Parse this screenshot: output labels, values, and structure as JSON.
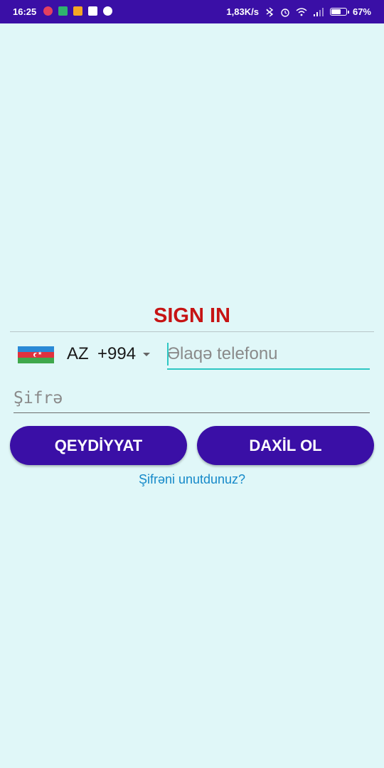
{
  "status_bar": {
    "time": "16:25",
    "network_speed": "1,83K/s",
    "battery_percent": "67%",
    "battery_level": 0.67,
    "notification_icons": [
      {
        "name": "instagram-icon",
        "color": "#e4405f"
      },
      {
        "name": "download-icon",
        "color": "#2fb36e"
      },
      {
        "name": "message-icon",
        "color": "#f5a623"
      },
      {
        "name": "news-icon",
        "color": "#ffffff"
      },
      {
        "name": "mail-icon",
        "color": "#ffffff"
      }
    ]
  },
  "signin": {
    "title": "SIGN IN",
    "country": {
      "flag": "azerbaijan-flag",
      "code": "AZ",
      "dial_code": "+994"
    },
    "phone_placeholder": "Əlaqə telefonu",
    "password_placeholder": "Şifrə",
    "register_button": "QEYDİYYAT",
    "login_button": "DAXİL OL",
    "forgot_password": "Şifrəni unutdunuz?"
  },
  "colors": {
    "background": "#e0f7f8",
    "primary": "#3a0fa6",
    "title": "#c61414",
    "accent": "#2ec7c3",
    "link": "#1589c9"
  }
}
